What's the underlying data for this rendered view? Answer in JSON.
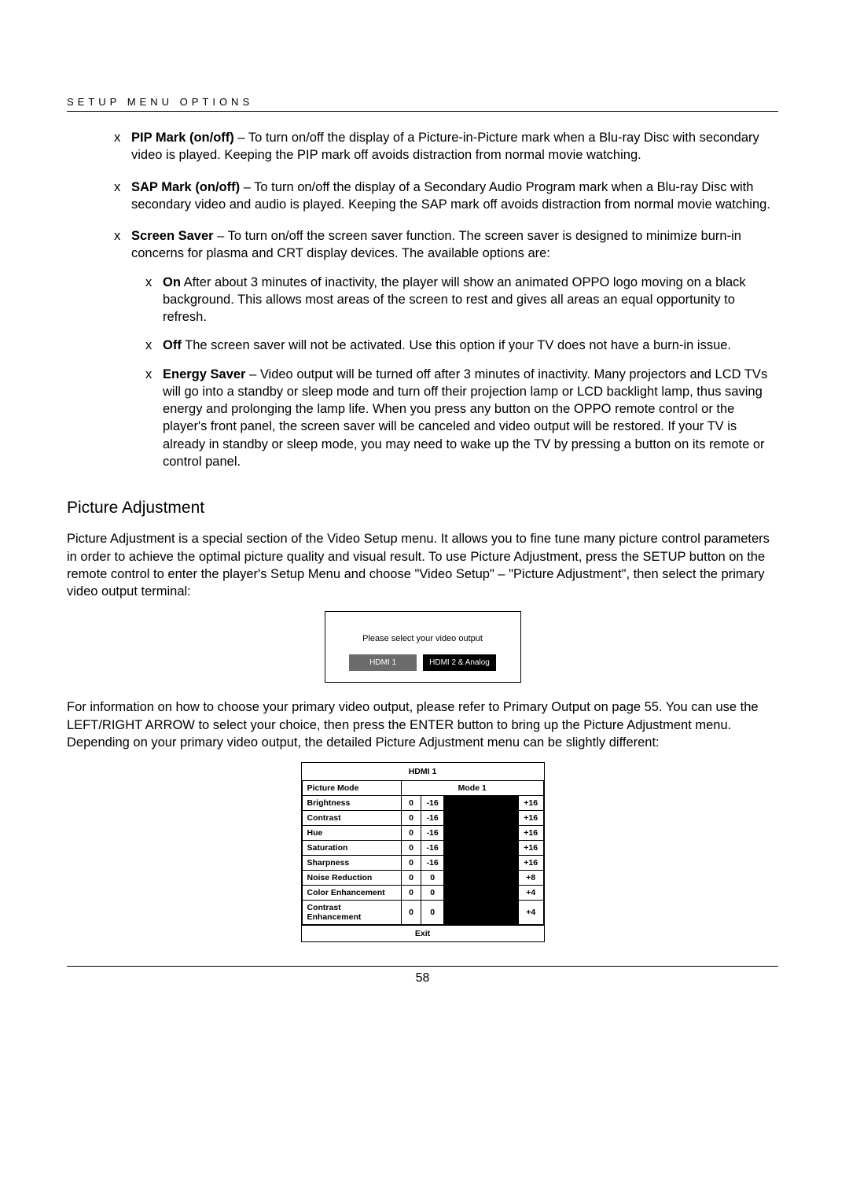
{
  "header": {
    "title": "SETUP MENU OPTIONS"
  },
  "bullets": [
    {
      "lead": "PIP Mark (on/off)",
      "body": " – To turn on/off the display of a Picture-in-Picture mark when a Blu-ray Disc with secondary video is played. Keeping the PIP mark off avoids distraction from normal movie watching.",
      "subs": []
    },
    {
      "lead": "SAP Mark (on/off)",
      "body": " – To turn on/off the display of a Secondary Audio Program mark when a Blu-ray Disc with secondary video and audio is played. Keeping the SAP mark off avoids distraction from normal movie watching.",
      "subs": []
    },
    {
      "lead": "Screen Saver",
      "body": " – To turn on/off the screen saver function. The screen saver is designed to minimize burn-in concerns for plasma and CRT display devices. The available options are:",
      "subs": [
        {
          "lead": "On",
          "body": "  After about 3 minutes of inactivity, the player will show an animated OPPO logo moving on a black background. This allows most areas of the screen to rest and gives all areas an equal opportunity to refresh."
        },
        {
          "lead": "Off",
          "body": "  The screen saver will not be activated. Use this option if your TV does not have a burn-in issue."
        },
        {
          "lead": "Energy Saver",
          "body": " – Video output will be turned off after 3 minutes of inactivity. Many projectors and LCD TVs will go into a standby or sleep mode and turn off their projection lamp or LCD backlight lamp, thus saving energy and prolonging the lamp life. When you press any button on the OPPO remote control or the player's front panel, the screen saver will be canceled and video output will be restored. If your TV is already in standby or sleep mode, you may need to wake up the TV by pressing a button on its remote or control panel."
        }
      ]
    }
  ],
  "section_title": "Picture Adjustment",
  "para1": "Picture Adjustment is a special section of the Video Setup menu. It allows you to fine tune many picture control parameters in order to achieve the optimal picture quality and visual result. To use Picture Adjustment, press the SETUP button on the remote control to enter the player's Setup Menu and choose \"Video Setup\" – \"Picture Adjustment\", then select the primary video output terminal:",
  "video_output": {
    "prompt": "Please select your video output",
    "opt1": "HDMI 1",
    "opt2": "HDMI 2 & Analog"
  },
  "para2": "For information on how to choose your primary video output, please refer to Primary Output  on page 55. You can use the LEFT/RIGHT ARROW to select your choice, then press the ENTER button to bring up the Picture Adjustment menu. Depending on your primary video output, the detailed Picture Adjustment menu can be slightly different:",
  "pa_table": {
    "title": "HDMI 1",
    "mode_label": "Picture Mode",
    "mode_value": "Mode 1",
    "rows": [
      {
        "name": "Brightness",
        "v": "0",
        "min": "-16",
        "max": "+16"
      },
      {
        "name": "Contrast",
        "v": "0",
        "min": "-16",
        "max": "+16"
      },
      {
        "name": "Hue",
        "v": "0",
        "min": "-16",
        "max": "+16"
      },
      {
        "name": "Saturation",
        "v": "0",
        "min": "-16",
        "max": "+16"
      },
      {
        "name": "Sharpness",
        "v": "0",
        "min": "-16",
        "max": "+16"
      },
      {
        "name": "Noise Reduction",
        "v": "0",
        "min": "0",
        "max": "+8"
      },
      {
        "name": "Color Enhancement",
        "v": "0",
        "min": "0",
        "max": "+4"
      },
      {
        "name": "Contrast Enhancement",
        "v": "0",
        "min": "0",
        "max": "+4"
      }
    ],
    "exit": "Exit"
  },
  "page_number": "58"
}
